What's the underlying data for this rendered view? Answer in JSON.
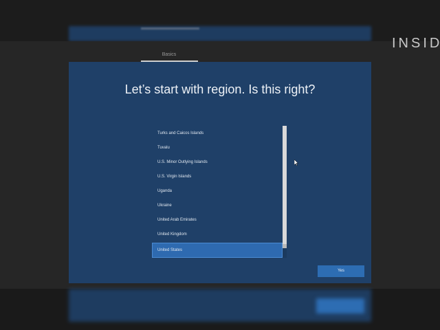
{
  "setup": {
    "tab_label": "Basics",
    "heading": "Let’s start with region. Is this right?"
  },
  "region_list": {
    "items": [
      {
        "label": "Turks and Caicos Islands",
        "selected": false
      },
      {
        "label": "Tuvalu",
        "selected": false
      },
      {
        "label": "U.S. Minor Outlying Islands",
        "selected": false
      },
      {
        "label": "U.S. Virgin Islands",
        "selected": false
      },
      {
        "label": "Uganda",
        "selected": false
      },
      {
        "label": "Ukraine",
        "selected": false
      },
      {
        "label": "United Arab Emirates",
        "selected": false
      },
      {
        "label": "United Kingdom",
        "selected": false
      },
      {
        "label": "United States",
        "selected": true
      }
    ]
  },
  "actions": {
    "yes_label": "Yes"
  },
  "overlay": {
    "watermark": "INSIDER"
  },
  "icons": {
    "cursor": "mouse-pointer-icon"
  },
  "colors": {
    "panel": "#1f4068",
    "accent": "#2d6db3",
    "background": "#262626"
  }
}
